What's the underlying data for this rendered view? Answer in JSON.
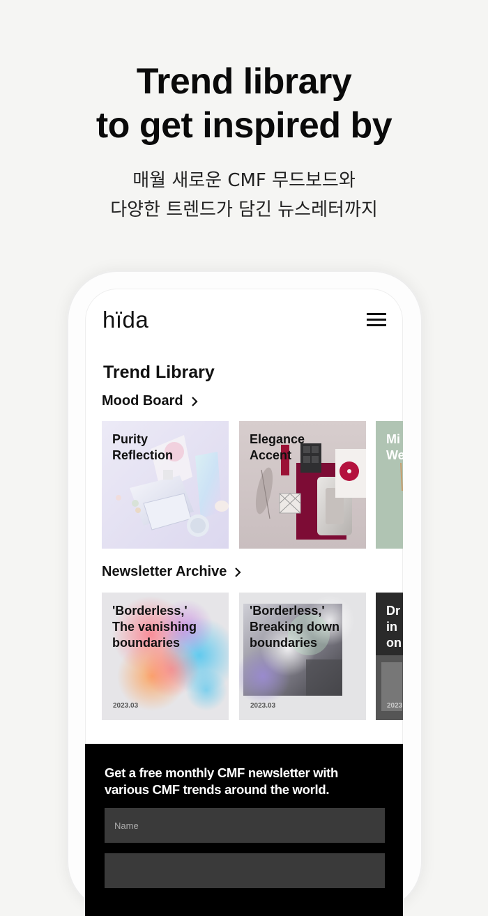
{
  "promo": {
    "headline_line1": "Trend library",
    "headline_line2": "to get inspired by",
    "sub_line1": "매월 새로운 CMF 무드보드와",
    "sub_line2": "다양한 트렌드가 담긴 뉴스레터까지"
  },
  "app": {
    "logo": "hïda",
    "page_title": "Trend Library",
    "mood_board": {
      "label": "Mood Board",
      "cards": [
        {
          "title": "Purity\nReflection"
        },
        {
          "title": "Elegance\nAccent"
        },
        {
          "title": "Mi\nWe"
        }
      ]
    },
    "newsletter_archive": {
      "label": "Newsletter Archive",
      "cards": [
        {
          "title": "'Borderless,'\nThe vanishing\nboundaries",
          "date": "2023.03"
        },
        {
          "title": "'Borderless,'\nBreaking down\nboundaries",
          "date": "2023.03"
        },
        {
          "title": "Dr\nin\non",
          "date": "2023"
        }
      ]
    },
    "signup": {
      "text": "Get a free monthly CMF newsletter with various CMF trends around the world.",
      "name_placeholder": "Name",
      "email_placeholder": ""
    }
  },
  "colors": {
    "background": "#f5f5f3",
    "newsletter_bg": "#000000",
    "input_bg": "#3a3a3a"
  }
}
